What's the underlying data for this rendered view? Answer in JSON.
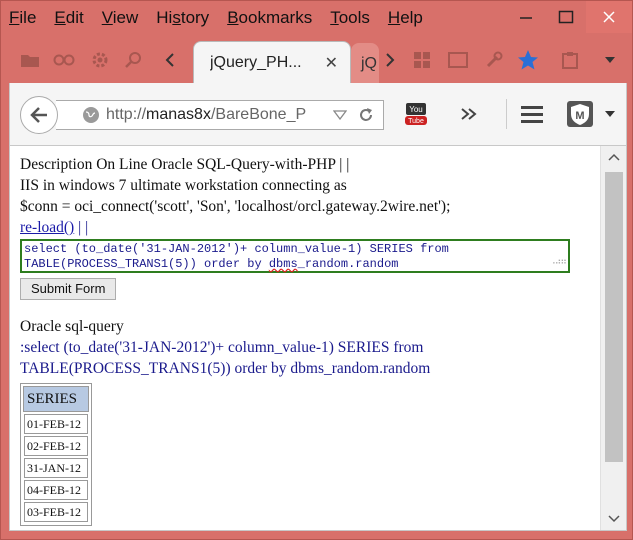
{
  "menu": {
    "items": [
      {
        "underline": "F",
        "rest": "ile"
      },
      {
        "underline": "E",
        "rest": "dit"
      },
      {
        "underline": "V",
        "rest": "iew"
      },
      {
        "underline": "",
        "pre": "Hi",
        "underline2": "s",
        "rest": "tory"
      },
      {
        "underline": "B",
        "rest": "ookmarks"
      },
      {
        "underline": "T",
        "rest": "ools"
      },
      {
        "underline": "H",
        "rest": "elp"
      }
    ]
  },
  "tabs": {
    "active_title": "jQuery_PH...",
    "next_title_fragment": "jQ"
  },
  "nav": {
    "url_prefix": "http://",
    "url_host": "manas8x",
    "url_path": "/BareBone_P"
  },
  "page": {
    "line1": "Description On Line Oracle SQL-Query-with-PHP | |",
    "line2": "IIS in windows 7 ultimate workstation connecting as",
    "line3": "$conn = oci_connect('scott', 'Son', 'localhost/orcl.gateway.2wire.net');",
    "reload_link": "re-load()",
    "reload_suffix": "| |",
    "sql_line1": "select (to_date('31-JAN-2012')+ column_value-1) SERIES from",
    "sql_line2_a": "TABLE(PROCESS_TRANS1(5)) order by ",
    "sql_line2_b": "dbms",
    "sql_line2_c": "_random.random",
    "submit_label": "Submit Form",
    "query_heading": "Oracle sql-query",
    "query_line1": ":select (to_date('31-JAN-2012')+ column_value-1) SERIES from",
    "query_line2": "TABLE(PROCESS_TRANS1(5)) order by dbms_random.random",
    "table_header": "SERIES",
    "rows": [
      "01-FEB-12",
      "02-FEB-12",
      "31-JAN-12",
      "04-FEB-12",
      "03-FEB-12"
    ]
  },
  "colors": {
    "frame": "#d8706a",
    "close_button": "#e0746d",
    "sql_border": "#2e7d1f",
    "table_header_bg": "#b7c9e2"
  }
}
